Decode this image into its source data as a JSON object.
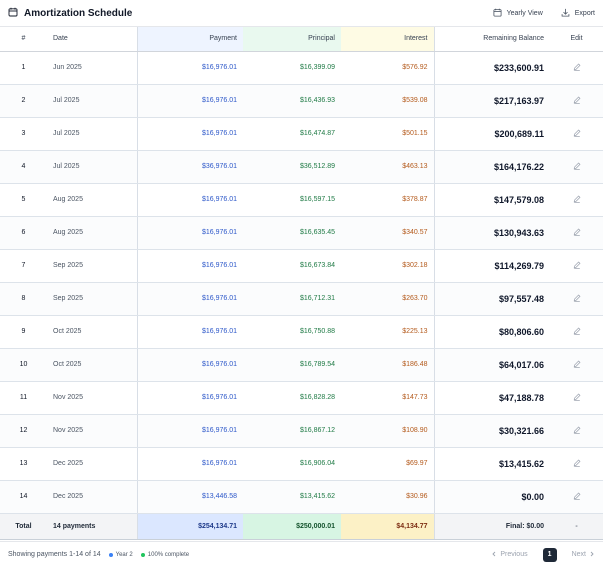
{
  "header": {
    "title": "Amortization Schedule",
    "yearly_view_label": "Yearly View",
    "export_label": "Export"
  },
  "columns": {
    "num": "#",
    "date": "Date",
    "payment": "Payment",
    "principal": "Principal",
    "interest": "Interest",
    "balance": "Remaining Balance",
    "edit": "Edit"
  },
  "rows": [
    {
      "num": "1",
      "date": "Jun 2025",
      "payment": "$16,976.01",
      "principal": "$16,399.09",
      "interest": "$576.92",
      "balance": "$233,600.91"
    },
    {
      "num": "2",
      "date": "Jul 2025",
      "payment": "$16,976.01",
      "principal": "$16,436.93",
      "interest": "$539.08",
      "balance": "$217,163.97"
    },
    {
      "num": "3",
      "date": "Jul 2025",
      "payment": "$16,976.01",
      "principal": "$16,474.87",
      "interest": "$501.15",
      "balance": "$200,689.11"
    },
    {
      "num": "4",
      "date": "Jul 2025",
      "payment": "$36,976.01",
      "principal": "$36,512.89",
      "interest": "$463.13",
      "balance": "$164,176.22"
    },
    {
      "num": "5",
      "date": "Aug 2025",
      "payment": "$16,976.01",
      "principal": "$16,597.15",
      "interest": "$378.87",
      "balance": "$147,579.08"
    },
    {
      "num": "6",
      "date": "Aug 2025",
      "payment": "$16,976.01",
      "principal": "$16,635.45",
      "interest": "$340.57",
      "balance": "$130,943.63"
    },
    {
      "num": "7",
      "date": "Sep 2025",
      "payment": "$16,976.01",
      "principal": "$16,673.84",
      "interest": "$302.18",
      "balance": "$114,269.79"
    },
    {
      "num": "8",
      "date": "Sep 2025",
      "payment": "$16,976.01",
      "principal": "$16,712.31",
      "interest": "$263.70",
      "balance": "$97,557.48"
    },
    {
      "num": "9",
      "date": "Oct 2025",
      "payment": "$16,976.01",
      "principal": "$16,750.88",
      "interest": "$225.13",
      "balance": "$80,806.60"
    },
    {
      "num": "10",
      "date": "Oct 2025",
      "payment": "$16,976.01",
      "principal": "$16,789.54",
      "interest": "$186.48",
      "balance": "$64,017.06"
    },
    {
      "num": "11",
      "date": "Nov 2025",
      "payment": "$16,976.01",
      "principal": "$16,828.28",
      "interest": "$147.73",
      "balance": "$47,188.78"
    },
    {
      "num": "12",
      "date": "Nov 2025",
      "payment": "$16,976.01",
      "principal": "$16,867.12",
      "interest": "$108.90",
      "balance": "$30,321.66"
    },
    {
      "num": "13",
      "date": "Dec 2025",
      "payment": "$16,976.01",
      "principal": "$16,906.04",
      "interest": "$69.97",
      "balance": "$13,415.62"
    },
    {
      "num": "14",
      "date": "Dec 2025",
      "payment": "$13,446.58",
      "principal": "$13,415.62",
      "interest": "$30.96",
      "balance": "$0.00"
    }
  ],
  "totals": {
    "label": "Total",
    "count": "14 payments",
    "payment": "$254,134.71",
    "principal": "$250,000.01",
    "interest": "$4,134.77",
    "balance": "Final: $0.00",
    "edit": "-"
  },
  "footer": {
    "showing": "Showing payments 1-14 of 14",
    "legend_year": "Year 2",
    "legend_complete": "100% complete",
    "prev_label": "Previous",
    "current_page": "1",
    "next_label": "Next"
  },
  "colors": {
    "payment": "#2c57c9",
    "principal": "#1f7a45",
    "interest": "#b45a1c",
    "legend_year": "#3b82f6",
    "legend_complete": "#22c55e"
  },
  "icons": {
    "title": "calendar-icon",
    "yearly_view": "calendar-icon",
    "export": "download-icon",
    "edit": "pencil-icon",
    "prev": "chevron-left-icon",
    "next": "chevron-right-icon"
  }
}
